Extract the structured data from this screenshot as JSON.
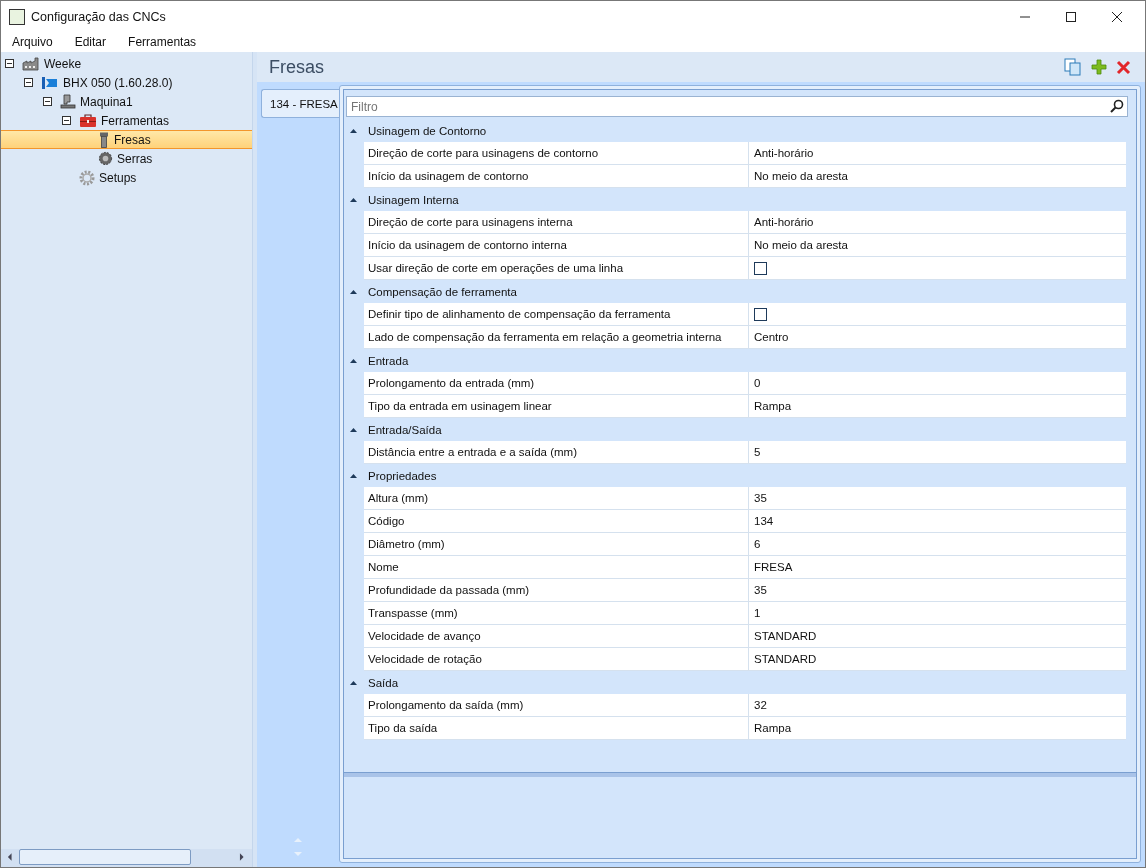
{
  "window": {
    "title": "Configuração das CNCs"
  },
  "menu": [
    "Arquivo",
    "Editar",
    "Ferramentas"
  ],
  "tree": [
    {
      "label": "Weeke",
      "kind": "factory",
      "expanded": true,
      "selected": false,
      "children": [
        {
          "label": "BHX 050 (1.60.28.0)",
          "kind": "bhx",
          "expanded": true,
          "selected": false,
          "children": [
            {
              "label": "Maquina1",
              "kind": "machine",
              "expanded": true,
              "selected": false,
              "children": [
                {
                  "label": "Ferramentas",
                  "kind": "toolbox",
                  "expanded": true,
                  "selected": false,
                  "children": [
                    {
                      "label": "Fresas",
                      "kind": "mill",
                      "selected": true
                    },
                    {
                      "label": "Serras",
                      "kind": "saw",
                      "selected": false
                    }
                  ]
                },
                {
                  "label": "Setups",
                  "kind": "gear",
                  "selected": false
                }
              ]
            }
          ]
        }
      ]
    }
  ],
  "panel": {
    "title": "Fresas"
  },
  "tabs": [
    {
      "label": "134 - FRESA",
      "selected": true
    }
  ],
  "filter": {
    "placeholder": "Filtro"
  },
  "categories": [
    {
      "name": "Usinagem de Contorno",
      "expanded": true,
      "rows": [
        {
          "kind": "text",
          "name": "Direção de corte para usinagens de contorno",
          "value": "Anti-horário"
        },
        {
          "kind": "text",
          "name": "Início da usinagem de contorno",
          "value": "No meio da aresta"
        }
      ]
    },
    {
      "name": "Usinagem Interna",
      "expanded": true,
      "rows": [
        {
          "kind": "text",
          "name": "Direção de corte para usinagens interna",
          "value": "Anti-horário"
        },
        {
          "kind": "text",
          "name": "Início da usinagem de contorno interna",
          "value": "No meio da aresta"
        },
        {
          "kind": "checkbox",
          "name": "Usar direção de corte em operações de uma linha",
          "checked": false
        }
      ]
    },
    {
      "name": "Compensação de ferramenta",
      "expanded": true,
      "rows": [
        {
          "kind": "checkbox",
          "name": "Definir tipo de alinhamento de compensação da ferramenta",
          "checked": false
        },
        {
          "kind": "text",
          "name": "Lado de compensação da ferramenta em relação a geometria interna",
          "value": "Centro"
        }
      ]
    },
    {
      "name": "Entrada",
      "expanded": true,
      "rows": [
        {
          "kind": "text",
          "name": "Prolongamento da entrada (mm)",
          "value": "0"
        },
        {
          "kind": "text",
          "name": "Tipo da entrada em usinagem linear",
          "value": "Rampa"
        }
      ]
    },
    {
      "name": "Entrada/Saída",
      "expanded": true,
      "rows": [
        {
          "kind": "text",
          "name": "Distância entre a entrada e a saída (mm)",
          "value": "5"
        }
      ]
    },
    {
      "name": "Propriedades",
      "expanded": true,
      "rows": [
        {
          "kind": "text",
          "name": "Altura (mm)",
          "value": "35"
        },
        {
          "kind": "text",
          "name": "Código",
          "value": "134"
        },
        {
          "kind": "text",
          "name": "Diâmetro (mm)",
          "value": "6"
        },
        {
          "kind": "text",
          "name": "Nome",
          "value": "FRESA"
        },
        {
          "kind": "text",
          "name": "Profundidade da passada (mm)",
          "value": "35"
        },
        {
          "kind": "text",
          "name": "Transpasse (mm)",
          "value": "1"
        },
        {
          "kind": "text",
          "name": "Velocidade de avanço",
          "value": "STANDARD"
        },
        {
          "kind": "text",
          "name": "Velocidade de rotação",
          "value": "STANDARD"
        }
      ]
    },
    {
      "name": "Saída",
      "expanded": true,
      "rows": [
        {
          "kind": "text",
          "name": "Prolongamento da saída (mm)",
          "value": "32"
        },
        {
          "kind": "text",
          "name": "Tipo da saída",
          "value": "Rampa"
        }
      ]
    }
  ]
}
